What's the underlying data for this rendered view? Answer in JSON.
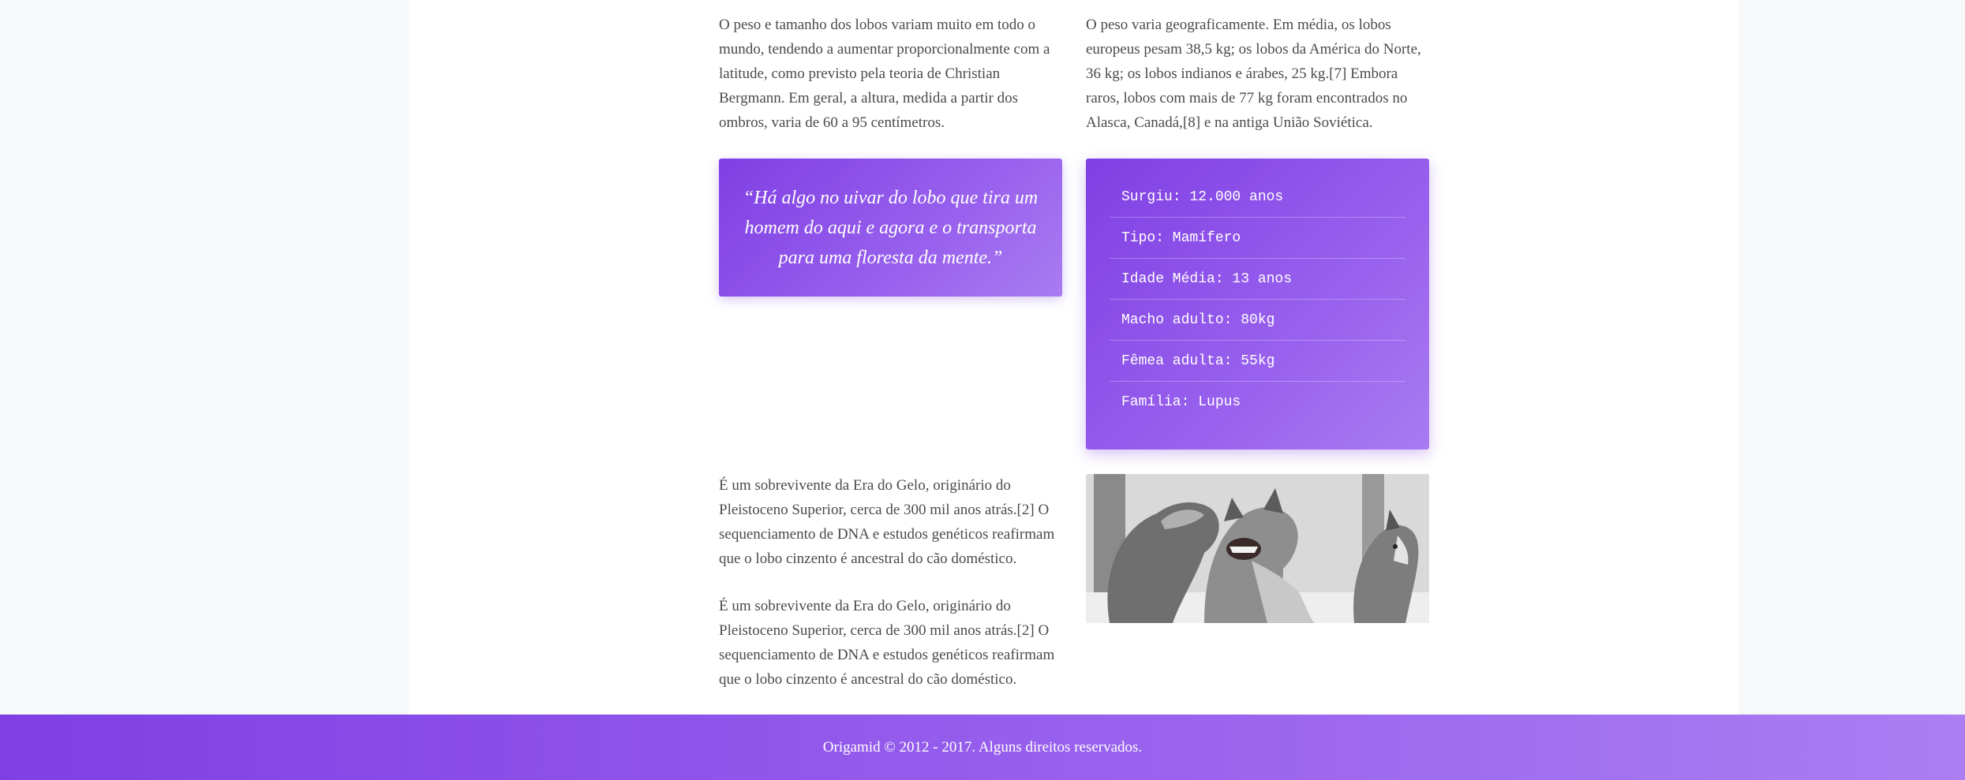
{
  "content": {
    "para_size": "O peso e tamanho dos lobos variam muito em todo o mundo, tendendo a aumentar proporcionalmente com a latitude, como previsto pela teoria de Christian Bergmann. Em geral, a altura, medida a partir dos ombros, varia de 60 a 95 centímetros.",
    "para_weight": "O peso varia geograficamente. Em média, os lobos europeus pesam 38,5 kg; os lobos da América do Norte, 36 kg; os lobos indianos e árabes, 25 kg.[7] Embora raros, lobos com mais de 77 kg foram encontrados no Alasca, Canadá,[8] e na antiga União Soviética.",
    "quote": "“Há algo no uivar do lobo que tira um homem do aqui e agora e o transporta para uma floresta da mente.”",
    "facts": [
      "Surgiu: 12.000 anos",
      "Tipo: Mamífero",
      "Idade Média: 13 anos",
      "Macho adulto: 80kg",
      "Fêmea adulta: 55kg",
      "Família: Lupus"
    ],
    "para_origin_1": "É um sobrevivente da Era do Gelo, originário do Pleistoceno Superior, cerca de 300 mil anos atrás.[2] O sequenciamento de DNA e estudos genéticos reafirmam que o lobo cinzento é ancestral do cão doméstico.",
    "para_origin_2": "É um sobrevivente da Era do Gelo, originário do Pleistoceno Superior, cerca de 300 mil anos atrás.[2] O sequenciamento de DNA e estudos genéticos reafirmam que o lobo cinzento é ancestral do cão doméstico."
  },
  "footer": {
    "text": "Origamid © 2012 - 2017. Alguns direitos reservados."
  },
  "colors": {
    "accent": "#7f3fe4",
    "accent_light": "#a97cf1"
  }
}
